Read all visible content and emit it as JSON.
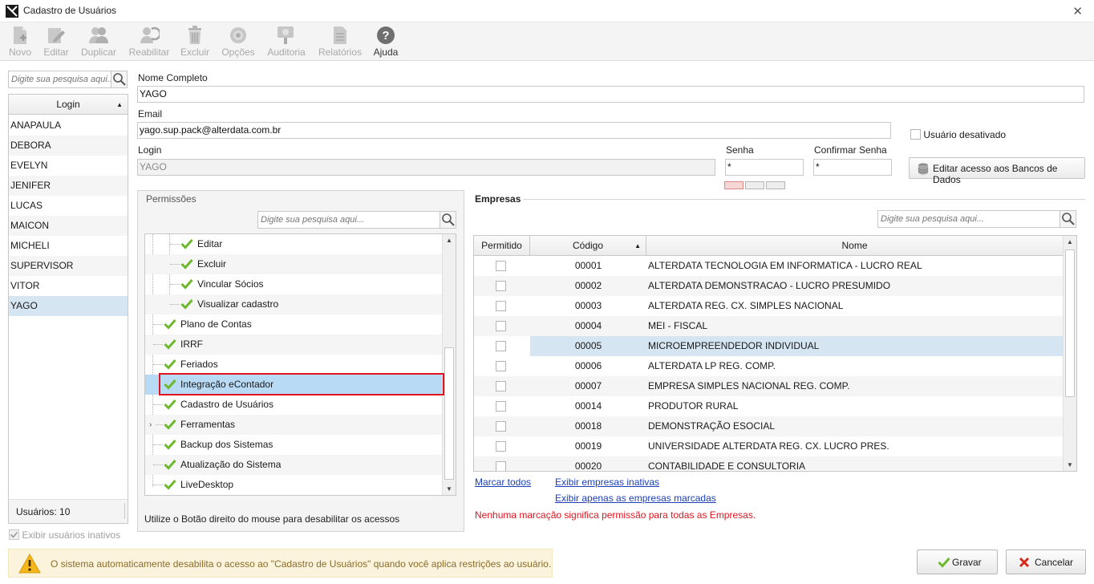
{
  "window": {
    "title": "Cadastro de Usuários",
    "close_label": "✕"
  },
  "toolbar": [
    {
      "label": "Novo",
      "icon": "new-doc-icon",
      "enabled": false
    },
    {
      "label": "Editar",
      "icon": "edit-icon",
      "enabled": false
    },
    {
      "label": "Duplicar",
      "icon": "duplicate-users-icon",
      "enabled": false
    },
    {
      "label": "Reabilitar",
      "icon": "reenable-icon",
      "enabled": false
    },
    {
      "label": "Excluir",
      "icon": "trash-icon",
      "enabled": false
    },
    {
      "label": "Opções",
      "icon": "gear-icon",
      "enabled": false
    },
    {
      "label": "Auditoria",
      "icon": "audit-icon",
      "enabled": false
    },
    {
      "label": "Relatórios",
      "icon": "report-icon",
      "enabled": false
    },
    {
      "label": "Ajuda",
      "icon": "help-icon",
      "enabled": true
    }
  ],
  "users": {
    "search_placeholder": "Digite sua pesquisa aqui...",
    "column": "Login",
    "items": [
      "ANAPAULA",
      "DEBORA",
      "EVELYN",
      "JENIFER",
      "LUCAS",
      "MAICON",
      "MICHELI",
      "SUPERVISOR",
      "VITOR",
      "YAGO"
    ],
    "selected": "YAGO",
    "count_label": "Usuários: 10",
    "show_inactive_label": "Exibir usuários inativos"
  },
  "form": {
    "name_label": "Nome Completo",
    "name_value": "YAGO",
    "email_label": "Email",
    "email_value": "yago.sup.pack@alterdata.com.br",
    "disabled_user_label": "Usuário desativado",
    "login_label": "Login",
    "login_value": "YAGO",
    "password_label": "Senha",
    "password_value": "*",
    "confirm_label": "Confirmar Senha",
    "confirm_value": "*",
    "edit_db_button": "Editar acesso aos Bancos de Dados"
  },
  "permissions": {
    "group_title": "Permissões",
    "search_placeholder": "Digite sua pesquisa aqui...",
    "tree": [
      {
        "label": "Editar",
        "level": 2
      },
      {
        "label": "Excluir",
        "level": 2
      },
      {
        "label": "Vincular Sócios",
        "level": 2
      },
      {
        "label": "Visualizar cadastro",
        "level": 2
      },
      {
        "label": "Plano de Contas",
        "level": 1
      },
      {
        "label": "IRRF",
        "level": 1
      },
      {
        "label": "Feriados",
        "level": 1
      },
      {
        "label": "Integração eContador",
        "level": 1,
        "highlighted": true
      },
      {
        "label": "Cadastro de Usuários",
        "level": 1
      },
      {
        "label": "Ferramentas",
        "level": 1,
        "expandable": true
      },
      {
        "label": "Backup dos Sistemas",
        "level": 1
      },
      {
        "label": "Atualização do Sistema",
        "level": 1
      },
      {
        "label": "LiveDesktop",
        "level": 1
      }
    ],
    "hint": "Utilize o Botão direito do mouse para desabilitar os acessos"
  },
  "empresas": {
    "title": "Empresas",
    "search_placeholder": "Digite sua pesquisa aqui...",
    "columns": [
      "Permitido",
      "Código",
      "Nome"
    ],
    "rows": [
      {
        "codigo": "00001",
        "nome": "ALTERDATA TECNOLOGIA EM INFORMATICA - LUCRO REAL"
      },
      {
        "codigo": "00002",
        "nome": "ALTERDATA DEMONSTRACAO  - LUCRO PRESUMIDO"
      },
      {
        "codigo": "00003",
        "nome": "ALTERDATA REG. CX.  SIMPLES NACIONAL"
      },
      {
        "codigo": "00004",
        "nome": "MEI - FISCAL"
      },
      {
        "codigo": "00005",
        "nome": "MICROEMPREENDEDOR INDIVIDUAL",
        "selected": true
      },
      {
        "codigo": "00006",
        "nome": "ALTERDATA LP REG. COMP."
      },
      {
        "codigo": "00007",
        "nome": "EMPRESA SIMPLES NACIONAL REG. COMP."
      },
      {
        "codigo": "00014",
        "nome": "PRODUTOR RURAL"
      },
      {
        "codigo": "00018",
        "nome": "DEMONSTRAÇÃO ESOCIAL"
      },
      {
        "codigo": "00019",
        "nome": "UNIVERSIDADE ALTERDATA REG. CX. LUCRO PRES."
      },
      {
        "codigo": "00020",
        "nome": "CONTABILIDADE E CONSULTORIA"
      }
    ],
    "mark_all": "Marcar todos",
    "show_inactive": "Exibir empresas inativas",
    "show_marked": "Exibir apenas as empresas marcadas",
    "note": "Nenhuma marcação significa permissão para todas as Empresas."
  },
  "footer": {
    "warning": "O sistema automaticamente desabilita o acesso ao \"Cadastro de Usuários\" quando você aplica restrições ao usuário.",
    "save_label": "Gravar",
    "cancel_label": "Cancelar"
  },
  "colors": {
    "accent_red": "#e0141e",
    "selection_blue": "#d5e5f2",
    "tree_highlight": "#b8daf5",
    "check_green": "#6cb82d",
    "link": "#1a3fb8"
  }
}
